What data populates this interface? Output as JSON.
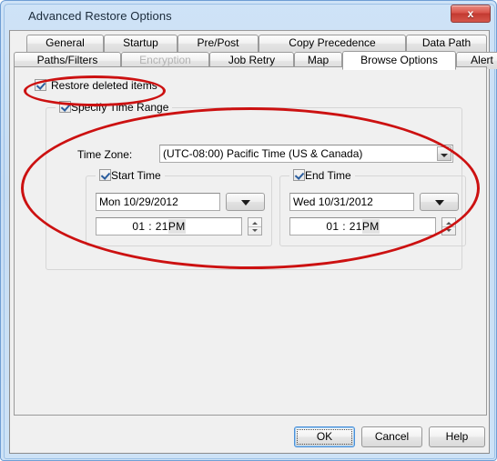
{
  "window": {
    "title": "Advanced Restore Options",
    "close_label": "x",
    "close_icon": "close-icon"
  },
  "tabs": {
    "row1": [
      {
        "label": "General",
        "state": "inactive"
      },
      {
        "label": "Startup",
        "state": "inactive"
      },
      {
        "label": "Pre/Post",
        "state": "inactive"
      },
      {
        "label": "Copy Precedence",
        "state": "inactive"
      },
      {
        "label": "Data Path",
        "state": "inactive"
      }
    ],
    "row2": [
      {
        "label": "Paths/Filters",
        "state": "inactive"
      },
      {
        "label": "Encryption",
        "state": "disabled"
      },
      {
        "label": "Job Retry",
        "state": "inactive"
      },
      {
        "label": "Map",
        "state": "inactive"
      },
      {
        "label": "Browse Options",
        "state": "active"
      },
      {
        "label": "Alert",
        "state": "inactive"
      }
    ]
  },
  "browse_options": {
    "restore_deleted_items": {
      "label": "Restore deleted items",
      "checked": true
    },
    "specify_time_range": {
      "label": "Specify Time Range",
      "checked": true,
      "time_zone": {
        "label": "Time Zone:",
        "value": "(UTC-08:00) Pacific Time (US & Canada)"
      },
      "start_time": {
        "label": "Start Time",
        "checked": true,
        "date": "Mon 10/29/2012",
        "time_value": "01 : 21",
        "time_meridiem": "PM"
      },
      "end_time": {
        "label": "End Time",
        "checked": true,
        "date": "Wed 10/31/2012",
        "time_value": "01 : 21",
        "time_meridiem": "PM"
      }
    }
  },
  "footer": {
    "ok_label": "OK",
    "cancel_label": "Cancel",
    "help_label": "Help"
  },
  "annotations": {
    "accent_color": "#cc1111",
    "items": [
      {
        "name": "highlight-restore-deleted-items"
      },
      {
        "name": "highlight-specify-time-range"
      }
    ]
  }
}
